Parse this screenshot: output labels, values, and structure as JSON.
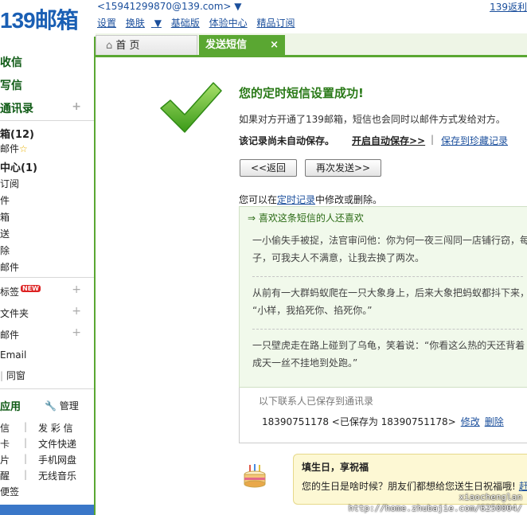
{
  "header": {
    "logo": "139邮箱",
    "account": "<15941299870@139.com>",
    "top_right_link": "139返利",
    "menu": [
      "设置",
      "换肤",
      "基础版",
      "体验中心",
      "精品订阅"
    ]
  },
  "tabs": [
    {
      "label": "首 页"
    },
    {
      "label": "发送短信",
      "close": "×"
    }
  ],
  "sidebar": {
    "top": [
      "收信",
      "写信",
      "通讯录"
    ],
    "folders": [
      {
        "label": "箱(12)"
      },
      {
        "label": "邮件"
      },
      {
        "label": "中心(1)"
      },
      {
        "label": "订阅"
      },
      {
        "label": "件"
      },
      {
        "label": "箱"
      },
      {
        "label": "送"
      },
      {
        "label": "除"
      },
      {
        "label": "邮件"
      }
    ],
    "tools": [
      "标签",
      "文件夹",
      "邮件",
      "Email",
      "同窗"
    ],
    "new_badge": "NEW",
    "apps_title": "应用",
    "manage": "管理",
    "apps": [
      {
        "left": "信",
        "right": "发 彩 信"
      },
      {
        "left": "卡",
        "right": "文件快递"
      },
      {
        "left": "片",
        "right": "手机网盘"
      },
      {
        "left": "醒",
        "right": "无线音乐"
      },
      {
        "left": "便签",
        "right": ""
      }
    ]
  },
  "main": {
    "title": "您的定时短信设置成功!",
    "info": "如果对方开通了139邮箱，短信也会同时以邮件方式发给对方。",
    "not_saved": "该记录尚未自动保存。",
    "auto_save": "开启自动保存>>",
    "save_fav": "保存到珍藏记录",
    "back_btn": "<<返回",
    "resend_btn": "再次发送>>",
    "modify_prefix": "您可以在",
    "modify_link": "定时记录",
    "modify_suffix": "中修改或删除。",
    "joke_head": "⇒ 喜欢这条短信的人还喜欢",
    "jokes": [
      [
        "一小偷失手被捉，法官审问他：你为何一夜三闯同一店铺行窃，每",
        "子，可我夫人不满意，让我去换了两次。"
      ],
      [
        "从前有一大群蚂蚁爬在一只大象身上，后来大象把蚂蚁都抖下来，",
        "“小样，我掐死你、掐死你。”"
      ],
      [
        "一只壁虎走在路上碰到了乌龟，笑着说：“你看这么热的天还背着",
        "成天一丝不挂地到处跑。”"
      ]
    ],
    "saved_head": "以下联系人已保存到通讯录",
    "saved_line": "18390751178 <已保存为 18390751178>",
    "edit": "修改",
    "delete": "删除",
    "bday_title": "填生日，享祝福",
    "bday_text": "您的生日是啥时候？朋友们都想给您送生日祝福哦!",
    "bday_link": "赶"
  },
  "watermark": [
    "xiaochenglan",
    "http://home.zhubajie.com/6250004/"
  ],
  "colors": {
    "accent": "#5aa732",
    "link": "#1b4f9c",
    "title": "#2a7a18"
  }
}
